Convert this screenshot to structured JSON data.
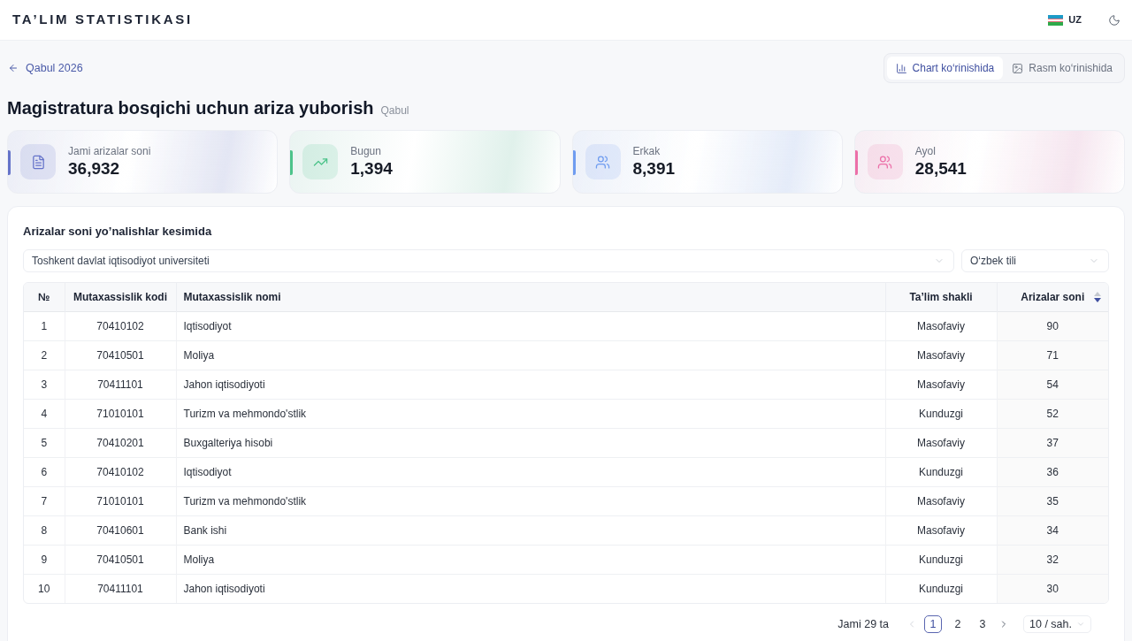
{
  "header": {
    "brand": "TA’LIM STATISTIKASI",
    "language": "UZ"
  },
  "breadcrumb": {
    "back_label": "Qabul 2026"
  },
  "view_toggle": [
    {
      "label": "Chart ko‘rinishida",
      "kind": "chart",
      "selected": true
    },
    {
      "label": "Rasm ko‘rinishida",
      "kind": "image",
      "selected": false
    }
  ],
  "page": {
    "title": "Magistratura bosqichi uchun ariza yuborish",
    "subtitle": "Qabul"
  },
  "stats": [
    {
      "label": "Jami arizalar soni",
      "value": "36,932",
      "kind": "document",
      "color": "#6573c9"
    },
    {
      "label": "Bugun",
      "value": "1,394",
      "kind": "trend",
      "color": "#4cc38a"
    },
    {
      "label": "Erkak",
      "value": "8,391",
      "kind": "people",
      "color": "#6f9cf0"
    },
    {
      "label": "Ayol",
      "value": "28,541",
      "kind": "people",
      "color": "#ec6fa8"
    }
  ],
  "table_panel": {
    "title": "Arizalar soni yo’nalishlar kesimida",
    "filters": [
      {
        "value": "Toshkent davlat iqtisodiyot universiteti"
      },
      {
        "value": "O‘zbek tili"
      }
    ],
    "table": {
      "columns": [
        {
          "label": "№"
        },
        {
          "label": "Mutaxassislik kodi"
        },
        {
          "label": "Mutaxassislik nomi"
        },
        {
          "label": "Ta’lim shakli"
        },
        {
          "label": "Arizalar soni",
          "sort_descending": true
        }
      ],
      "rows": [
        [
          "1",
          "70410102",
          "Iqtisodiyot",
          "Masofaviy",
          "90"
        ],
        [
          "2",
          "70410501",
          "Moliya",
          "Masofaviy",
          "71"
        ],
        [
          "3",
          "70411101",
          "Jahon iqtisodiyoti",
          "Masofaviy",
          "54"
        ],
        [
          "4",
          "71010101",
          "Turizm va mehmondo'stlik",
          "Kunduzgi",
          "52"
        ],
        [
          "5",
          "70410201",
          "Buxgalteriya hisobi",
          "Masofaviy",
          "37"
        ],
        [
          "6",
          "70410102",
          "Iqtisodiyot",
          "Kunduzgi",
          "36"
        ],
        [
          "7",
          "71010101",
          "Turizm va mehmondo'stlik",
          "Masofaviy",
          "35"
        ],
        [
          "8",
          "70410601",
          "Bank ishi",
          "Masofaviy",
          "34"
        ],
        [
          "9",
          "70410501",
          "Moliya",
          "Kunduzgi",
          "32"
        ],
        [
          "10",
          "70411101",
          "Jahon iqtisodiyoti",
          "Kunduzgi",
          "30"
        ]
      ]
    },
    "pagination": {
      "total": "Jami 29 ta",
      "prev_disabled": true,
      "next_disabled": false,
      "pages": [
        {
          "label": "1",
          "selected": true
        },
        {
          "label": "2",
          "selected": false
        },
        {
          "label": "3",
          "selected": false
        }
      ],
      "page_size": "10 / sah."
    }
  }
}
